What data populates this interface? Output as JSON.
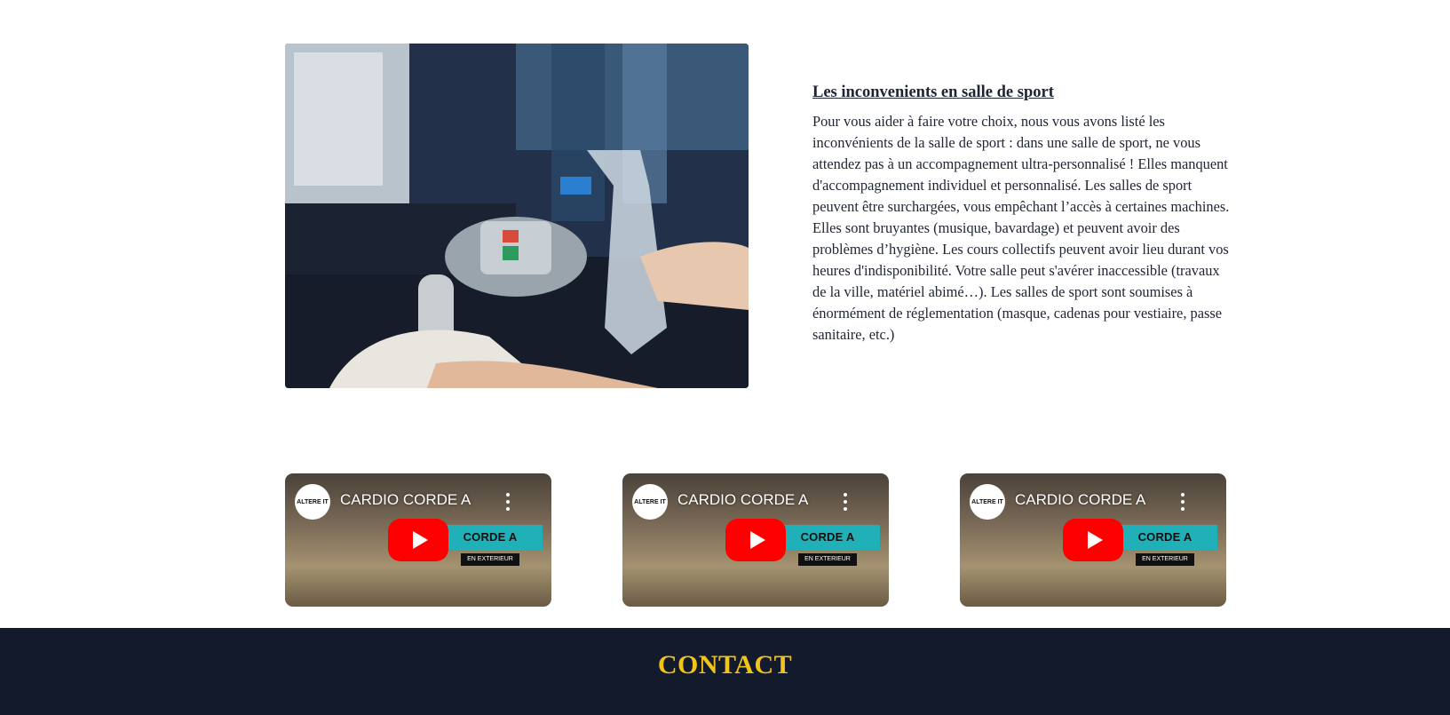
{
  "article": {
    "heading": "Les inconvenients en salle de sport",
    "body": "Pour vous aider à faire votre choix, nous vous avons listé les inconvénients de la salle de sport : dans une salle de sport, ne vous attendez pas à un accompagnement ultra-personnalisé ! Elles manquent d'accompagnement individuel et personnalisé. Les salles de sport peuvent être surchargées, vous empêchant l’accès à certaines machines. Elles sont bruyantes (musique, bavardage) et peuvent avoir des problèmes d’hygiène. Les cours collectifs peuvent avoir lieu durant vos heures d'indisponibilité. Votre salle peut s'avérer inaccessible (travaux de la ville, matériel abimé…). Les salles de sport sont soumises à énormément de réglementation (masque, cadenas pour vestiaire, passe sanitaire, etc.)"
  },
  "videos": [
    {
      "title": "CARDIO CORDE A S...",
      "channel_logo": "ALTERE IT",
      "banner": "CORDE A SAUTER",
      "banner_sub": "EN EXTERIEUR"
    },
    {
      "title": "CARDIO CORDE A S...",
      "channel_logo": "ALTERE IT",
      "banner": "CORDE A SAUTER",
      "banner_sub": "EN EXTERIEUR"
    },
    {
      "title": "CARDIO CORDE A S...",
      "channel_logo": "ALTERE IT",
      "banner": "CORDE A SAUTER",
      "banner_sub": "EN EXTERIEUR"
    }
  ],
  "footer": {
    "title": "CONTACT"
  },
  "colors": {
    "footer_bg": "#121a2b",
    "footer_title": "#f2c318",
    "play_button": "#ff0000",
    "banner": "#1fb0b8"
  }
}
